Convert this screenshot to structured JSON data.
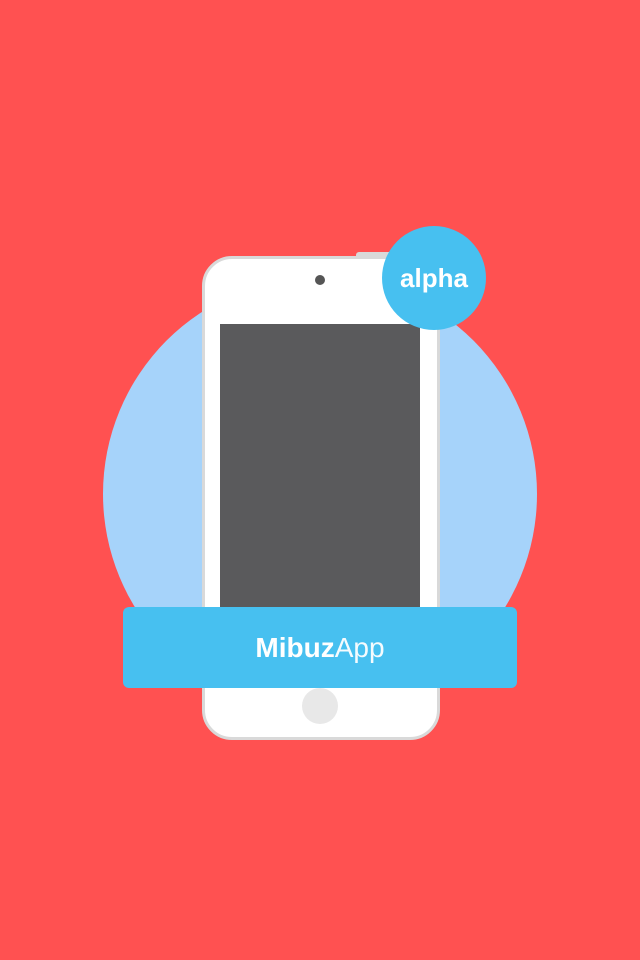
{
  "splash": {
    "badge_label": "alpha",
    "brand_name_bold": "Mibuz",
    "brand_name_light": "App"
  },
  "colors": {
    "background": "#ff5151",
    "circle": "#a6d3fa",
    "accent": "#47c0f0",
    "screen": "#5a5a5c",
    "phone_body": "#ffffff",
    "phone_border": "#d9d9d9"
  },
  "icons": {
    "device": "smartphone-illustration"
  }
}
